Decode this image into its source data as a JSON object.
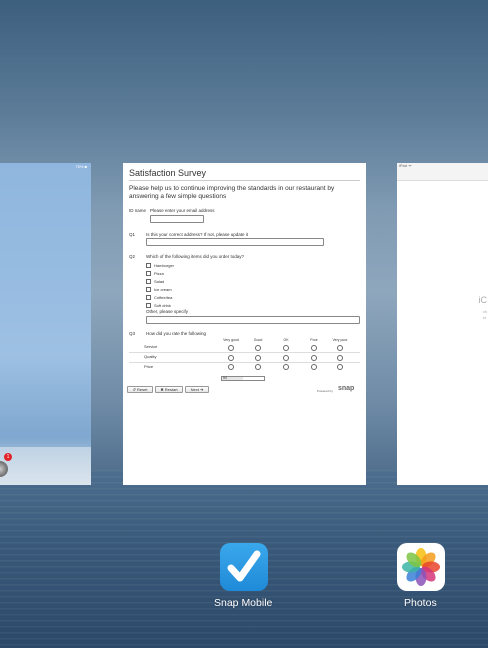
{
  "left_card": {
    "status_text": "75% ■",
    "badge_count": "1"
  },
  "survey": {
    "title": "Satisfaction Survey",
    "intro": "Please help us to continue improving the standards in our restaurant by answering a few simple questions",
    "id_label": "ID name",
    "id_hint": "Please enter your email address",
    "q1_number": "Q1",
    "q1_text": "Is this your correct address? If not, please update it",
    "q2_number": "Q2",
    "q2_text": "Which of the following items did you order today?",
    "q2_items": [
      "Hamburger",
      "Pizza",
      "Salad",
      "Ice cream",
      "Coffee/tea",
      "Soft drink"
    ],
    "q2_other_label": "Other, please specify",
    "q3_number": "Q3",
    "q3_text": "How did you rate the following",
    "q3_columns": [
      "Very good",
      "Good",
      "OK",
      "Poor",
      "Very poor"
    ],
    "q3_rows": [
      "Service",
      "Quality",
      "Price"
    ],
    "progress_text": "50",
    "progress_fraction": 0.5,
    "buttons": {
      "reset": "↺ Reset",
      "restart": "✖ Restart",
      "next": "Next ➔"
    },
    "powered_by": "Powered by",
    "brand": "snap"
  },
  "right_card": {
    "status_text": "iPad ᯤ",
    "fragment_large": "iC",
    "fragment_small": "ch\nst"
  },
  "dock": {
    "snap_label": "Snap Mobile",
    "photos_label": "Photos"
  },
  "colors": {
    "snap_icon": "#2b9be3",
    "badge": "#e2232a"
  }
}
